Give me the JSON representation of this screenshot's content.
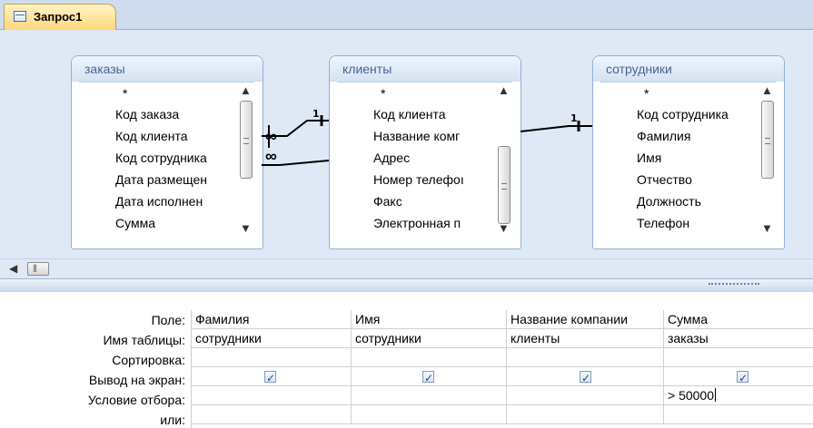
{
  "tab": {
    "label": "Запрос1",
    "icon": "query-design-icon"
  },
  "tables": [
    {
      "name": "заказы",
      "fields": [
        "*",
        "Код заказа",
        "Код клиента",
        "Код сотрудника",
        "Дата размещен",
        "Дата исполнен",
        "Сумма"
      ],
      "key_field": "Код заказа"
    },
    {
      "name": "клиенты",
      "fields": [
        "*",
        "Код клиента",
        "Название комг",
        "Адрес",
        "Номер телефоı",
        "Факс",
        "Электронная п"
      ],
      "key_field": "Код клиента"
    },
    {
      "name": "сотрудники",
      "fields": [
        "*",
        "Код сотрудника",
        "Фамилия",
        "Имя",
        "Отчество",
        "Должность",
        "Телефон"
      ],
      "key_field": "Код сотрудника"
    }
  ],
  "relations": {
    "one": "1",
    "many": "∞"
  },
  "grid": {
    "row_labels": [
      "Поле:",
      "Имя таблицы:",
      "Сортировка:",
      "Вывод на экран:",
      "Условие отбора:",
      "или:"
    ],
    "columns": [
      {
        "field": "Фамилия",
        "table": "сотрудники",
        "sort": "",
        "show": true,
        "criteria": ""
      },
      {
        "field": "Имя",
        "table": "сотрудники",
        "sort": "",
        "show": true,
        "criteria": ""
      },
      {
        "field": "Название компании",
        "table": "клиенты",
        "sort": "",
        "show": true,
        "criteria": ""
      },
      {
        "field": "Сумма",
        "table": "заказы",
        "sort": "",
        "show": true,
        "criteria": "> 50000"
      }
    ]
  }
}
